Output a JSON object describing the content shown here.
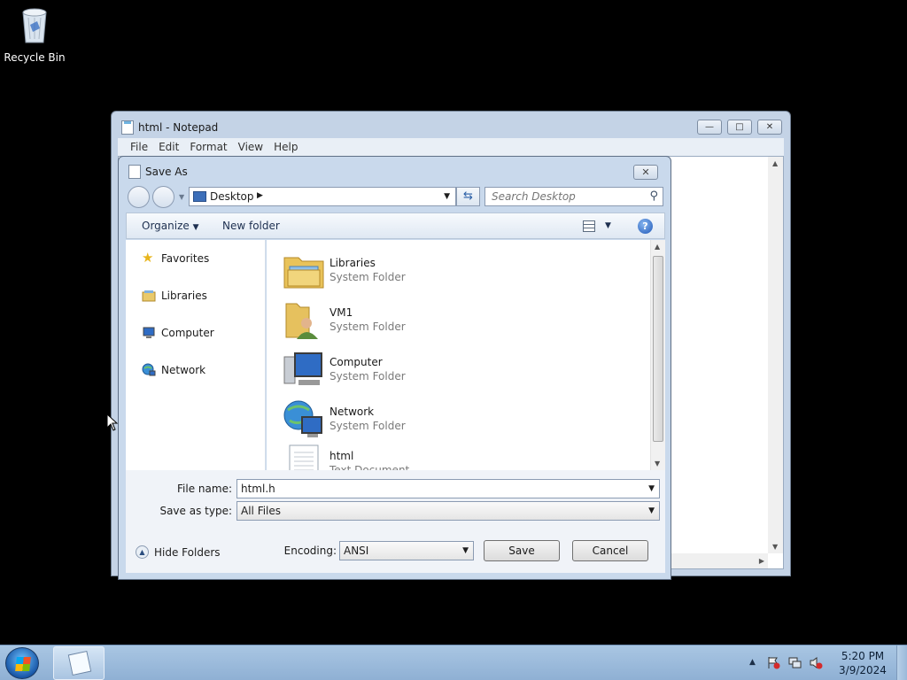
{
  "desktop": {
    "recycle_bin_label": "Recycle Bin"
  },
  "notepad": {
    "title": "html - Notepad",
    "menu": [
      "File",
      "Edit",
      "Format",
      "View",
      "Help"
    ]
  },
  "save_dialog": {
    "title": "Save As",
    "address": "Desktop",
    "search_placeholder": "Search Desktop",
    "toolbar": {
      "organize": "Organize",
      "new_folder": "New folder"
    },
    "nav_items": [
      "Favorites",
      "Libraries",
      "Computer",
      "Network"
    ],
    "files": [
      {
        "name": "Libraries",
        "type": "System Folder"
      },
      {
        "name": "VM1",
        "type": "System Folder"
      },
      {
        "name": "Computer",
        "type": "System Folder"
      },
      {
        "name": "Network",
        "type": "System Folder"
      },
      {
        "name": "html",
        "type": "Text Document"
      }
    ],
    "file_name_label": "File name:",
    "file_name_value": "html.h",
    "save_as_type_label": "Save as type:",
    "save_as_type_value": "All Files",
    "encoding_label": "Encoding:",
    "encoding_value": "ANSI",
    "save_button": "Save",
    "cancel_button": "Cancel",
    "hide_folders": "Hide Folders"
  },
  "taskbar": {
    "time": "5:20 PM",
    "date": "3/9/2024"
  },
  "colors": {
    "taskbar": "#a9c6e3",
    "dialog_frame": "#c9d9ec",
    "desktop": "#000000"
  }
}
